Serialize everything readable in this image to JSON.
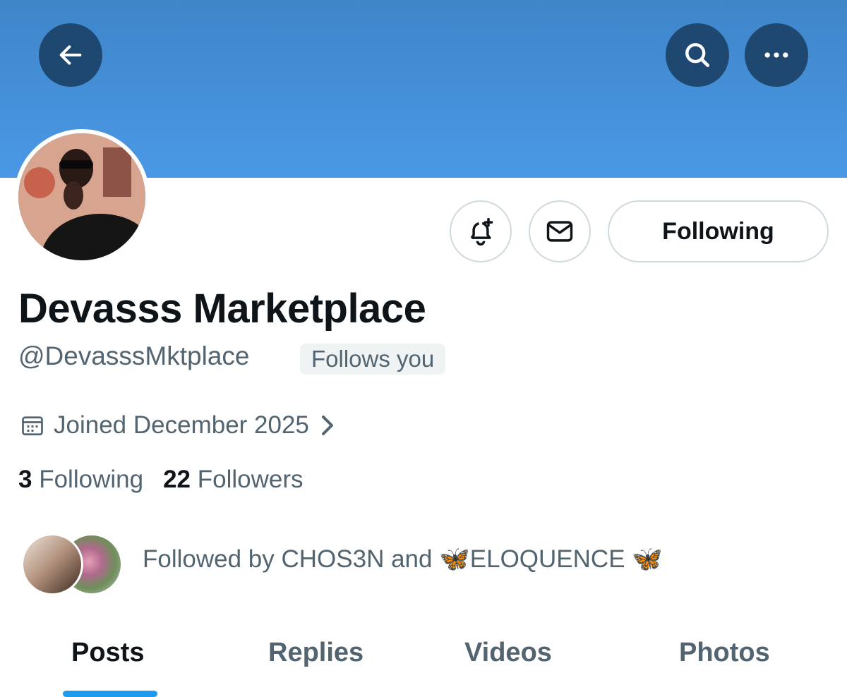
{
  "header": {
    "back_icon": "arrow-left-icon",
    "search_icon": "search-icon",
    "more_icon": "more-horizontal-icon",
    "banner_color": "#4a98e6"
  },
  "profile": {
    "display_name": "Devasss Marketplace",
    "handle": "@DevasssMktplace",
    "follows_you": "Follows you",
    "joined": "Joined December 2025",
    "following_count": "3",
    "following_label": "Following",
    "followers_count": "22",
    "followers_label": "Followers",
    "followed_by_text": "Followed by CHOS3N and 🦋ELOQUENCE 🦋"
  },
  "actions": {
    "notify_icon": "bell-plus-icon",
    "message_icon": "mail-icon",
    "following_button": "Following"
  },
  "tabs": [
    {
      "label": "Posts",
      "active": true
    },
    {
      "label": "Replies",
      "active": false
    },
    {
      "label": "Videos",
      "active": false
    },
    {
      "label": "Photos",
      "active": false
    }
  ],
  "colors": {
    "accent": "#1d9bf0",
    "text_primary": "#0f1419",
    "text_secondary": "#536471"
  }
}
